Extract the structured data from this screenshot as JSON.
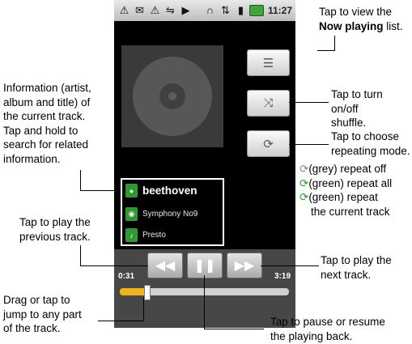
{
  "status_bar": {
    "left_icons": [
      "warning-icon",
      "mail-crossed-icon",
      "warning-icon",
      "usb-icon",
      "play-icon"
    ],
    "right_icons": [
      "headphones-icon",
      "mobile-data-icon",
      "signal-icon",
      "battery-icon"
    ],
    "time": "11:27"
  },
  "player": {
    "artist": "beethoven",
    "album": "Symphony No9",
    "title": "Presto",
    "elapsed": "0:31",
    "duration": "3:19",
    "progress": 0.156
  },
  "annotations": {
    "now_playing": {
      "line1": "Tap to view the",
      "bold": "Now playing",
      "suffix": " list."
    },
    "shuffle": {
      "line1": "Tap to turn on/off",
      "line2": "shuffle."
    },
    "repeat": {
      "line1": "Tap to choose",
      "line2": "repeating mode.",
      "legend_off": "(grey) repeat off",
      "legend_all": "(green) repeat all",
      "legend_current_1": "(green) repeat",
      "legend_current_2": "the current track"
    },
    "info": {
      "line1": "Information (artist,",
      "line2": "album and title) of",
      "line3": "the current track.",
      "line4": "Tap and hold to",
      "line5": "search for related",
      "line6": "information."
    },
    "previous": {
      "line1": "Tap to play the",
      "line2": "previous track."
    },
    "next": {
      "line1": "Tap to play the",
      "line2": "next track."
    },
    "seek": {
      "line1": "Drag or tap to",
      "line2": "jump to any part",
      "line3": "of the track."
    },
    "pause": {
      "line1": "Tap to pause or resume",
      "line2": "the playing back."
    }
  }
}
